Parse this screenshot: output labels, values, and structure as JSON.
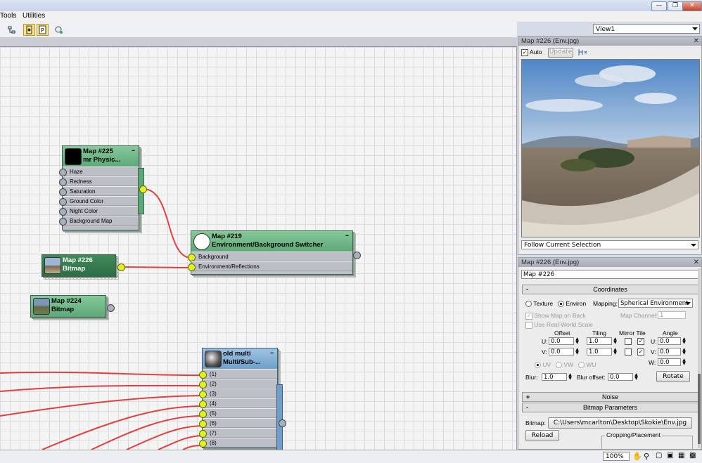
{
  "menu": {
    "items": [
      "Tools",
      "Utilities"
    ]
  },
  "toolbar": {
    "view_select": "View1"
  },
  "nodes": {
    "n225": {
      "id": "Map #225",
      "type": "mr Physic...",
      "slots": [
        "Haze",
        "Redness",
        "Saturation",
        "Ground Color",
        "Night Color",
        "Background Map"
      ]
    },
    "n219": {
      "id": "Map #219",
      "type": "Environment/Background Switcher",
      "slots": [
        "Background",
        "Environment/Reflections"
      ]
    },
    "n226": {
      "id": "Map #226",
      "type": "Bitmap"
    },
    "n224": {
      "id": "Map #224",
      "type": "Bitmap"
    },
    "multi": {
      "id": "old multi",
      "type": "Multi/Sub-...",
      "slots": [
        "(1)",
        "(2)",
        "(3)",
        "(4)",
        "(5)",
        "(6)",
        "(7)",
        "(8)"
      ]
    }
  },
  "preview": {
    "title": "Map #226 (Env.jpg)",
    "auto_label": "Auto",
    "update_label": "Update",
    "follow_label": "Follow Current Selection"
  },
  "params": {
    "title": "Map #226 (Env.jpg)",
    "name_value": "Map #226",
    "coordinates": {
      "rollout": "Coordinates",
      "texture": "Texture",
      "environ": "Environ",
      "mapping_label": "Mapping:",
      "mapping_value": "Spherical Environment",
      "map_channel_label": "Map Channel:",
      "map_channel_value": "1",
      "show_map_on_back": "Show Map on Back",
      "use_real_world": "Use Real-World Scale",
      "col_offset": "Offset",
      "col_tiling": "Tiling",
      "col_mirror_tile": "Mirror Tile",
      "col_angle": "Angle",
      "u_label": "U:",
      "v_label": "V:",
      "w_label": "W:",
      "u_offset": "0.0",
      "v_offset": "0.0",
      "u_tiling": "1.0",
      "v_tiling": "1.0",
      "u_angle": "0.0",
      "v_angle": "0.0",
      "w_angle": "0.0",
      "uv": "UV",
      "vw": "VW",
      "wu": "WU",
      "blur_label": "Blur:",
      "blur_value": "1.0",
      "blur_offset_label": "Blur offset:",
      "blur_offset_value": "0.0",
      "rotate_label": "Rotate"
    },
    "noise_rollout": "Noise",
    "bitmap_rollout": "Bitmap Parameters",
    "bitmap_label": "Bitmap:",
    "bitmap_path": "C:\\Users\\mcarlton\\Desktop\\Skokie\\Env.jpg",
    "reload_label": "Reload",
    "cropping_label": "Cropping/Placement"
  },
  "status": {
    "zoom": "100%"
  }
}
